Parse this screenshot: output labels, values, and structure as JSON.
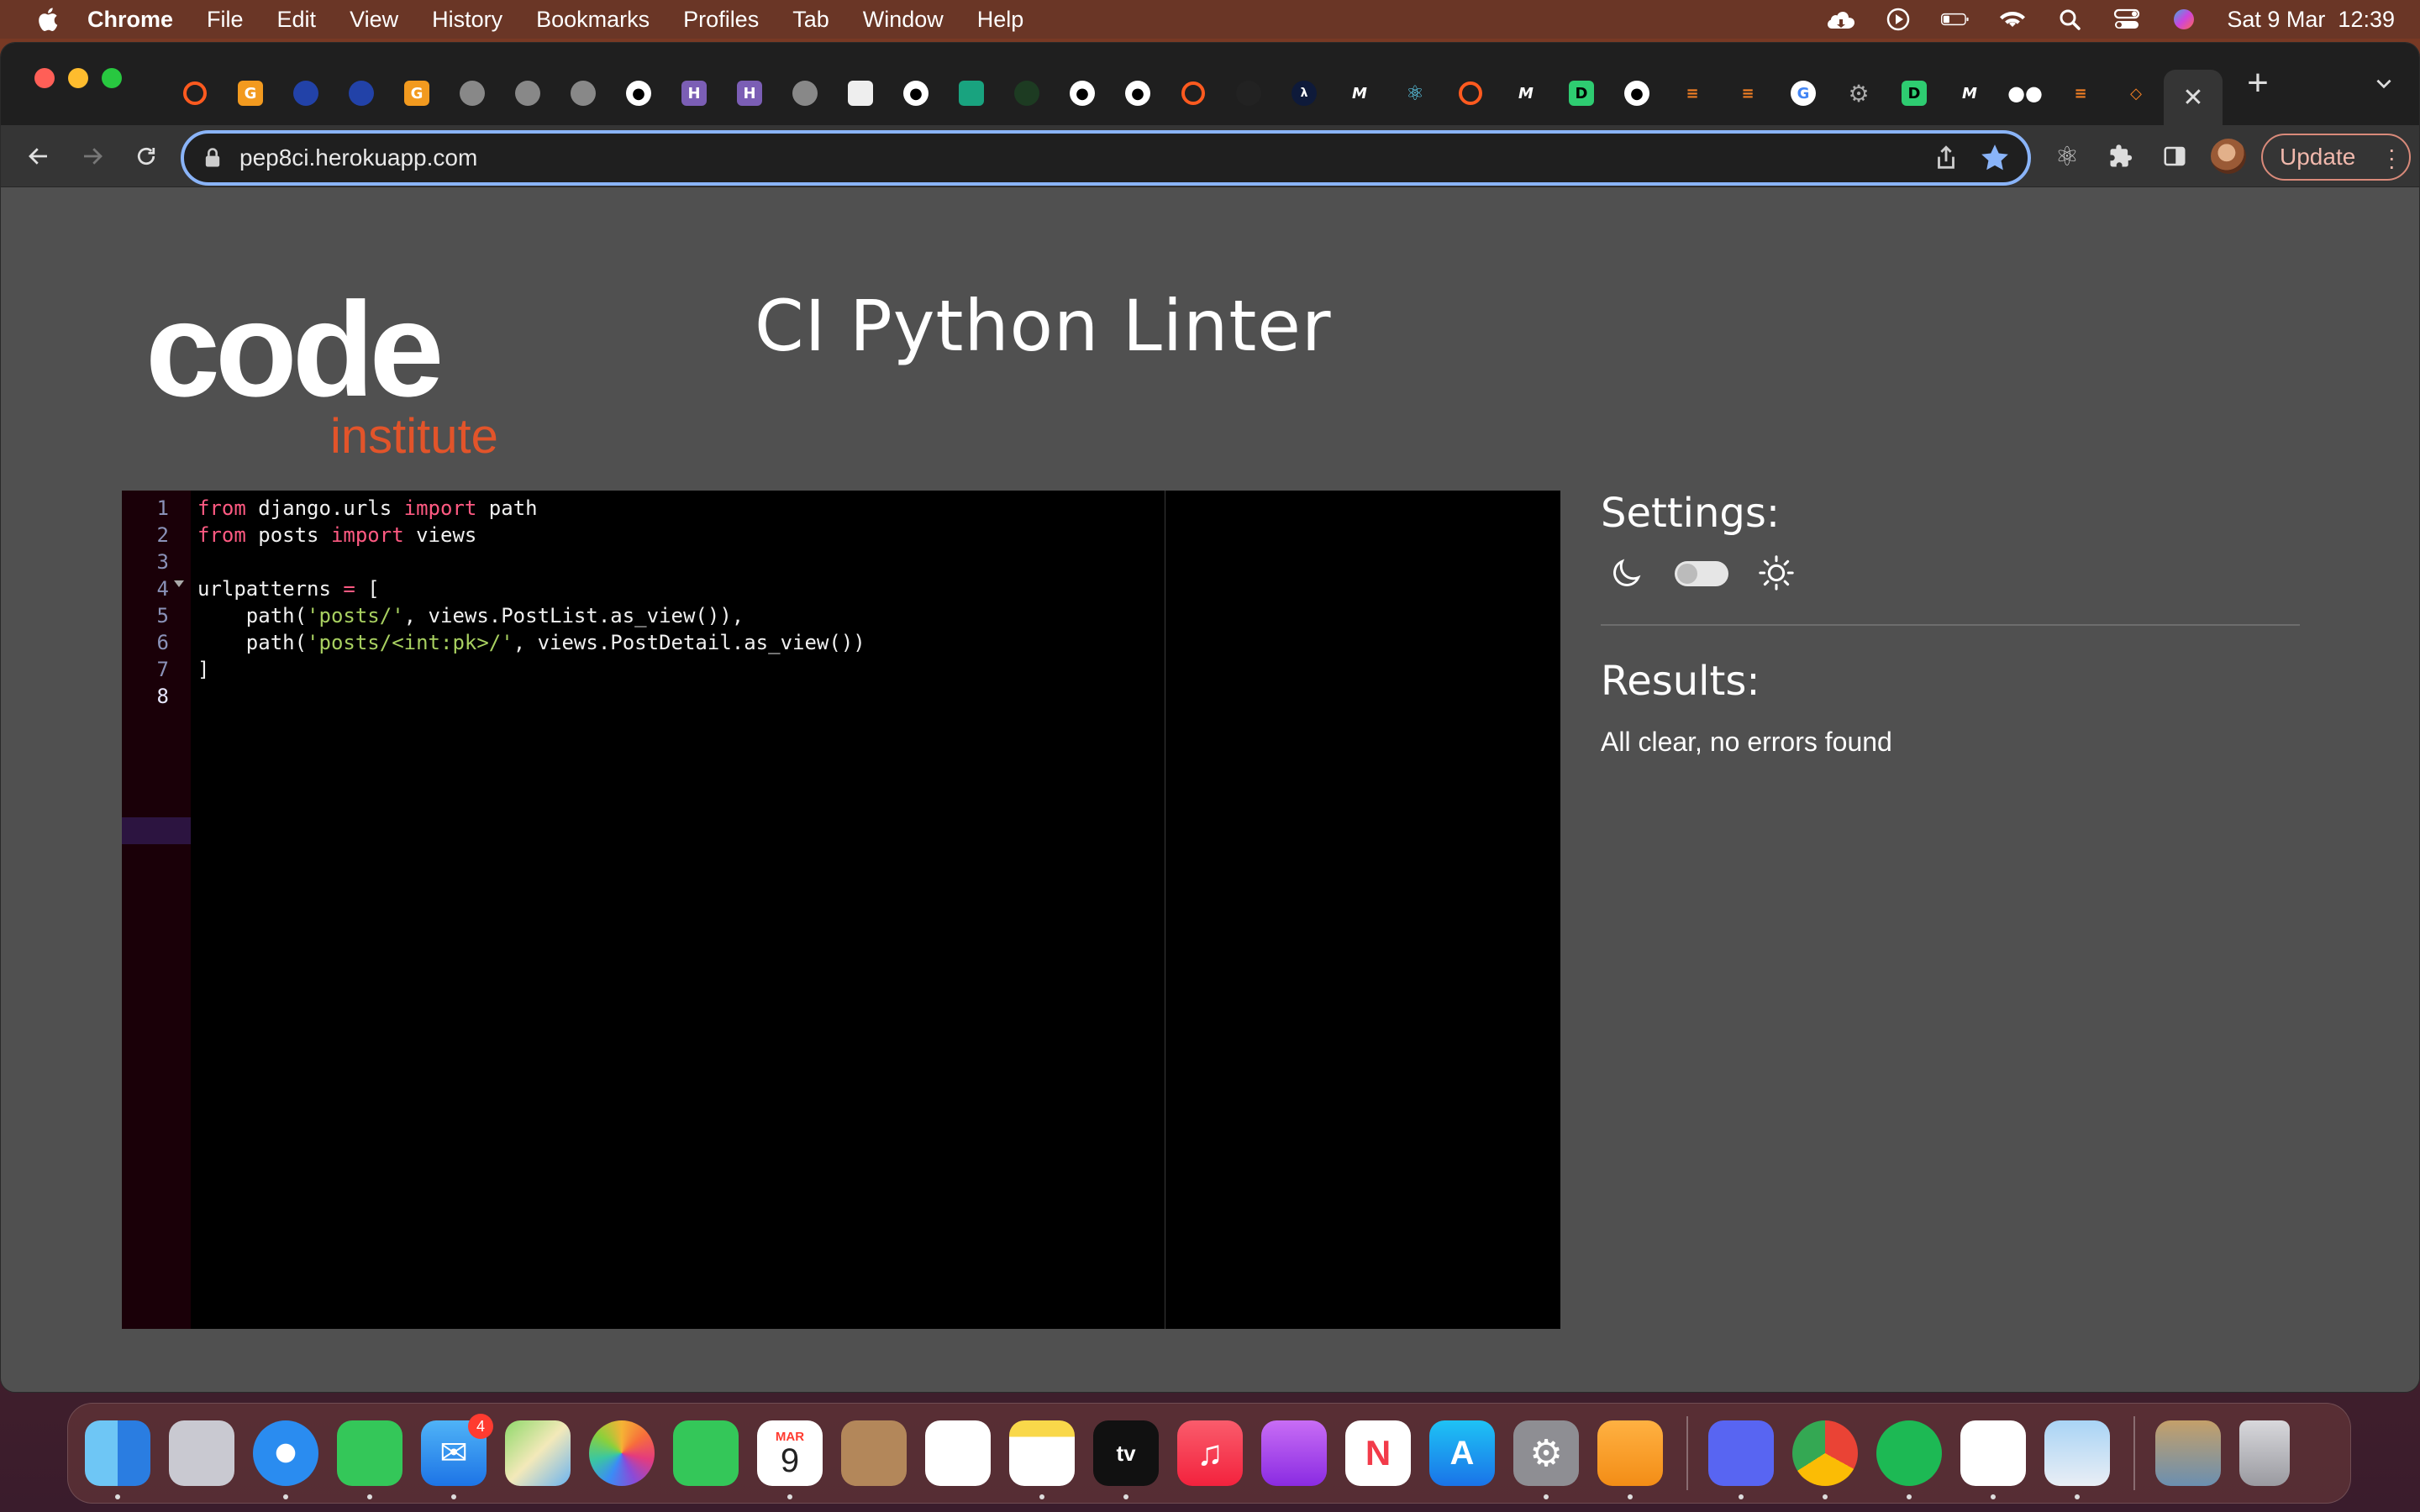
{
  "menubar": {
    "app_name": "Chrome",
    "items": [
      "File",
      "Edit",
      "View",
      "History",
      "Bookmarks",
      "Profiles",
      "Tab",
      "Window",
      "Help"
    ],
    "clock": "Sat 9 Mar  12:39"
  },
  "browser": {
    "url": "pep8ci.herokuapp.com",
    "update_label": "Update"
  },
  "page": {
    "title": "CI Python Linter",
    "logo_word": "code",
    "logo_sub": "institute",
    "settings_title": "Settings:",
    "results_title": "Results:",
    "results_text": "All clear, no errors found",
    "code_lines": [
      {
        "num": "1",
        "parts": [
          {
            "t": "from",
            "c": "kw"
          },
          {
            "t": " django.urls ",
            "c": ""
          },
          {
            "t": "import",
            "c": "kw"
          },
          {
            "t": " path",
            "c": ""
          }
        ]
      },
      {
        "num": "2",
        "parts": [
          {
            "t": "from",
            "c": "kw"
          },
          {
            "t": " posts ",
            "c": ""
          },
          {
            "t": "import",
            "c": "kw"
          },
          {
            "t": " views",
            "c": ""
          }
        ]
      },
      {
        "num": "3",
        "parts": []
      },
      {
        "num": "4",
        "parts": [
          {
            "t": "urlpatterns ",
            "c": ""
          },
          {
            "t": "=",
            "c": "kw"
          },
          {
            "t": " [",
            "c": ""
          }
        ]
      },
      {
        "num": "5",
        "parts": [
          {
            "t": "    path(",
            "c": ""
          },
          {
            "t": "'posts/'",
            "c": "str"
          },
          {
            "t": ", views.PostList.as_view()),",
            "c": ""
          }
        ]
      },
      {
        "num": "6",
        "parts": [
          {
            "t": "    path(",
            "c": ""
          },
          {
            "t": "'posts/<int:pk>/'",
            "c": "str"
          },
          {
            "t": ", views.PostDetail.as_view())",
            "c": ""
          }
        ]
      },
      {
        "num": "7",
        "parts": [
          {
            "t": "]",
            "c": ""
          }
        ]
      },
      {
        "num": "8",
        "parts": []
      }
    ]
  },
  "colors": {
    "page_bg": "#505050",
    "editor_bg": "#000000",
    "keyword": "#ff5a82",
    "string": "#a8d060",
    "logo_orange": "#e2542a"
  },
  "dock": {
    "mail_badge": "4",
    "calendar_month": "MAR",
    "calendar_day": "9",
    "tv_label": "tv"
  }
}
